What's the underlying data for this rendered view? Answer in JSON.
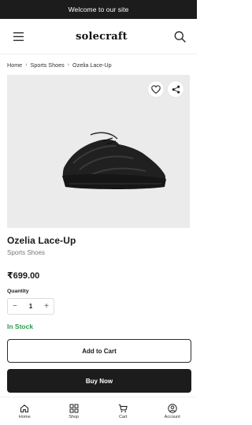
{
  "announcement": "Welcome to our site",
  "header": {
    "logo": "solecraft",
    "icons": [
      "menu-icon",
      "search-icon"
    ]
  },
  "breadcrumb": [
    "Home",
    "Sports Shoes",
    "Ozelia Lace-Up"
  ],
  "breadcrumb_separator": "›",
  "product": {
    "name": "Ozelia Lace-Up",
    "category": "Sports Shoes",
    "price": "₹699.00",
    "quantity_label": "Quantity",
    "quantity": "1",
    "stock_status": "In Stock",
    "image_icons": [
      "heart-icon",
      "share-icon"
    ]
  },
  "actions": {
    "add_to_cart": "Add to Cart",
    "buy_now": "Buy Now"
  },
  "bottom_nav": [
    {
      "label": "Home",
      "icon": "home-icon"
    },
    {
      "label": "Shop",
      "icon": "grid-icon"
    },
    {
      "label": "Cart",
      "icon": "cart-icon"
    },
    {
      "label": "Account",
      "icon": "user-icon"
    }
  ],
  "colors": {
    "dark": "#1c1c1c",
    "stock_green": "#2e9a4e",
    "image_bg": "#ebebeb"
  }
}
